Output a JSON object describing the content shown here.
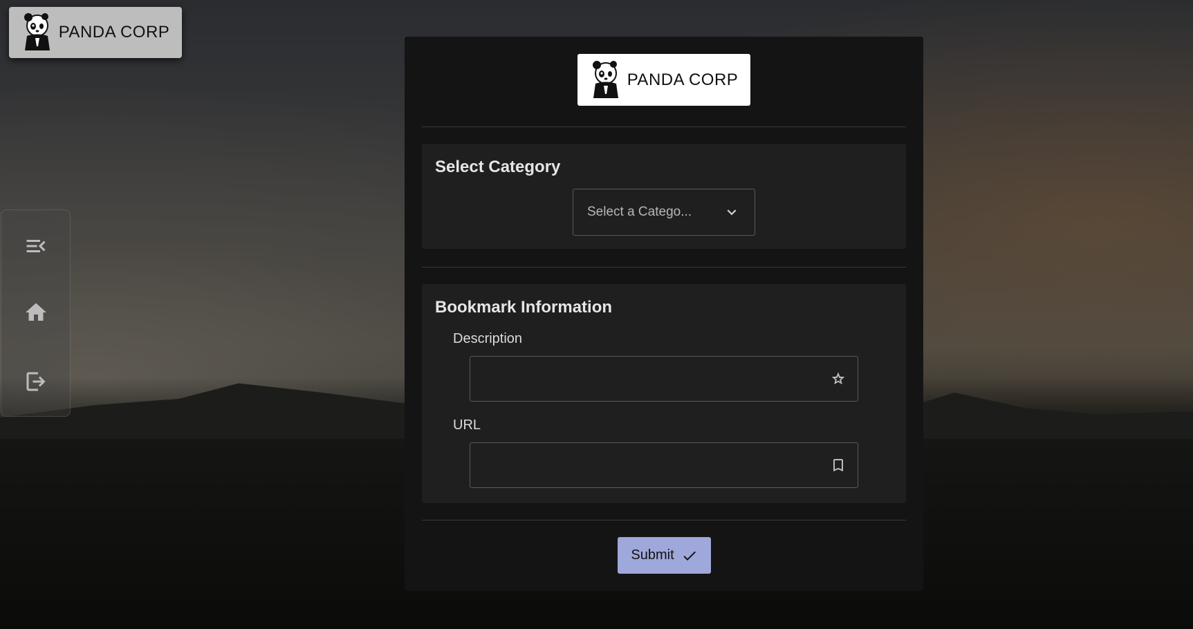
{
  "brand": {
    "name": "PANDA CORP"
  },
  "sidebar": {
    "items": [
      {
        "name": "menu-collapse",
        "icon": "menu-open-icon"
      },
      {
        "name": "home",
        "icon": "home-icon"
      },
      {
        "name": "logout",
        "icon": "logout-icon"
      }
    ]
  },
  "category_section": {
    "title": "Select Category",
    "select": {
      "value": "Select a Catego...",
      "icon": "chevron-down-icon"
    }
  },
  "bookmark_section": {
    "title": "Bookmark Information",
    "description": {
      "label": "Description",
      "value": "",
      "icon": "star-outline-icon"
    },
    "url": {
      "label": "URL",
      "value": "",
      "icon": "bookmark-outline-icon"
    }
  },
  "submit": {
    "label": "Submit",
    "icon": "check-icon",
    "color": "#9fa8da"
  },
  "colors": {
    "card": "#141414",
    "section": "#1f1f1f",
    "accent": "#9fa8da"
  }
}
